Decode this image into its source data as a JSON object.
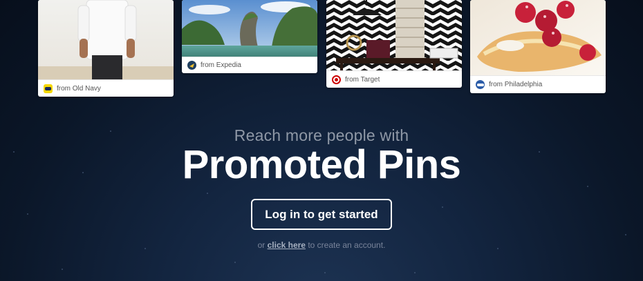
{
  "pins": [
    {
      "source": "from Old Navy",
      "icon": "old-navy-logo-icon",
      "badge_color": "#f6d800"
    },
    {
      "source": "from Expedia",
      "icon": "expedia-logo-icon",
      "badge_color": "#1f3f60"
    },
    {
      "source": "from Target",
      "icon": "target-logo-icon",
      "badge_color": "#cc0000"
    },
    {
      "source": "from Philadelphia",
      "icon": "philadelphia-logo-icon",
      "badge_color": "#2b5ca8"
    }
  ],
  "hero": {
    "subheading": "Reach more people with",
    "heading": "Promoted Pins"
  },
  "cta": {
    "label": "Log in to get started"
  },
  "signup": {
    "prefix": "or",
    "link": "click here",
    "suffix": "to create an account."
  },
  "colors": {
    "background": "#0b1729",
    "text": "#ffffff",
    "muted": "#8f98a6"
  }
}
